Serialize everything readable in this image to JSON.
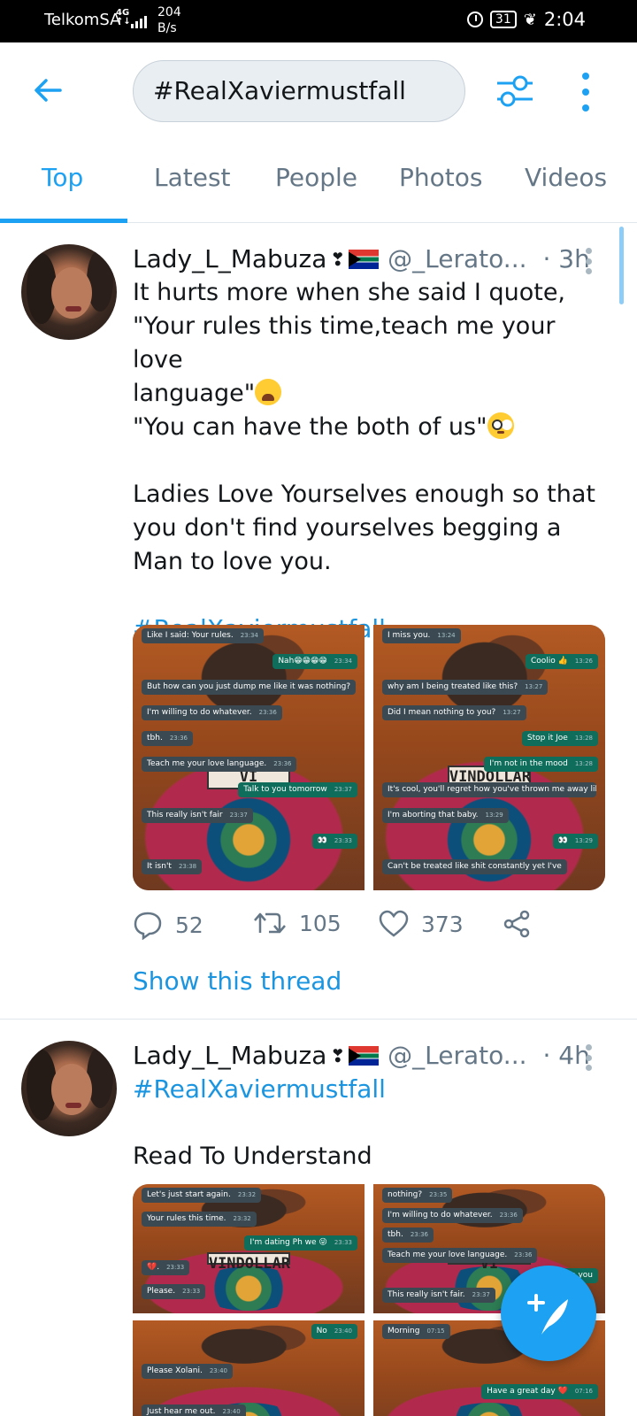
{
  "status_bar": {
    "carrier": "TelkomSA",
    "network": "4G",
    "data_speed_value": "204",
    "data_speed_unit": "B/s",
    "battery": "31",
    "time": "2:04"
  },
  "search": {
    "query": "#RealXaviermustfall"
  },
  "tabs": [
    {
      "label": "Top",
      "active": true
    },
    {
      "label": "Latest",
      "active": false
    },
    {
      "label": "People",
      "active": false
    },
    {
      "label": "Photos",
      "active": false
    },
    {
      "label": "Videos",
      "active": false
    }
  ],
  "colors": {
    "accent": "#1da1f2",
    "link": "#1b95e0",
    "muted": "#657786"
  },
  "tweets": [
    {
      "name": "Lady_L_Mabuza",
      "handle": "@_Lerato...",
      "time": "· 3h",
      "lines": [
        "It hurts more when she said I quote,",
        "\"Your rules this time,teach me your love",
        "language\"",
        "\"You can have the both of us\""
      ],
      "para2": "Ladies Love Yourselves enough so that you don't find yourselves begging a Man to love you.",
      "hashtag": "#RealXaviermustfall",
      "images": [
        {
          "cap": "VI",
          "bubbles": [
            {
              "text": "Like I said: Your rules.",
              "time": "23:34",
              "out": false
            },
            {
              "text": "Nah😁😁😁😁",
              "time": "23:34",
              "out": true
            },
            {
              "text": "But how can you just dump me like it was nothing?",
              "time": "23:35",
              "out": false
            },
            {
              "text": "I'm willing to do whatever.",
              "time": "23:36",
              "out": false
            },
            {
              "text": "tbh.",
              "time": "23:36",
              "out": false
            },
            {
              "text": "Teach me your love language.",
              "time": "23:36",
              "out": false
            },
            {
              "text": "Talk to you tomorrow",
              "time": "23:37",
              "out": true
            },
            {
              "text": "This really isn't fair",
              "time": "23:37",
              "out": false
            },
            {
              "text": "👀",
              "time": "23:33",
              "out": true
            },
            {
              "text": "It isn't",
              "time": "23:38",
              "out": false
            }
          ]
        },
        {
          "cap": "VINDOLLAR",
          "bubbles": [
            {
              "text": "I miss you.",
              "time": "13:24",
              "out": false
            },
            {
              "text": "Coolio 👍",
              "time": "13:26",
              "out": true
            },
            {
              "text": "why am I being treated like this?",
              "time": "13:27",
              "out": false
            },
            {
              "text": "Did I mean nothing to you?",
              "time": "13:27",
              "out": false
            },
            {
              "text": "Stop it Joe",
              "time": "13:28",
              "out": true
            },
            {
              "text": "I'm not in the mood",
              "time": "13:28",
              "out": true
            },
            {
              "text": "It's cool, you'll regret how you've thrown me away like I mean nothing.",
              "time": "13:29",
              "out": false
            },
            {
              "text": "I'm aborting that baby.",
              "time": "13:29",
              "out": false
            },
            {
              "text": "👀",
              "time": "13:29",
              "out": true
            },
            {
              "text": "Can't be treated like shit constantly yet I've",
              "time": "",
              "out": false
            }
          ]
        }
      ],
      "replies": "52",
      "retweets": "105",
      "likes": "373",
      "thread_link": "Show this thread"
    },
    {
      "name": "Lady_L_Mabuza",
      "handle": "@_Lerato...",
      "time": "· 4h",
      "hashtag": "#RealXaviermustfall",
      "body": "Read To Understand",
      "images": [
        {
          "cap": "VINDOLLAR",
          "bubbles": [
            {
              "text": "Let's just start again.",
              "time": "23:32",
              "out": false
            },
            {
              "text": "Your rules this time.",
              "time": "23:32",
              "out": false
            },
            {
              "text": "I'm dating Ph we 😜",
              "time": "23:33",
              "out": true
            },
            {
              "text": "💔.",
              "time": "23:33",
              "out": false
            },
            {
              "text": "Please.",
              "time": "23:33",
              "out": false
            }
          ]
        },
        {
          "cap": "VI",
          "bubbles": [
            {
              "text": "nothing?",
              "time": "23:35",
              "out": false
            },
            {
              "text": "I'm willing to do whatever.",
              "time": "23:36",
              "out": false
            },
            {
              "text": "tbh.",
              "time": "23:36",
              "out": false
            },
            {
              "text": "Teach me your love language.",
              "time": "23:36",
              "out": false
            },
            {
              "text": "Talk to you",
              "time": "",
              "out": true
            },
            {
              "text": "This really isn't fair.",
              "time": "23:37",
              "out": false
            }
          ]
        },
        {
          "cap": "",
          "bubbles": [
            {
              "text": "No",
              "time": "23:40",
              "out": true
            },
            {
              "text": "Please Xolani.",
              "time": "23:40",
              "out": false
            },
            {
              "text": "Just hear me out.",
              "time": "23:40",
              "out": false
            }
          ]
        },
        {
          "cap": "",
          "bubbles": [
            {
              "text": "Morning",
              "time": "07:15",
              "out": false
            },
            {
              "text": "Have a great day ❤️",
              "time": "07:16",
              "out": true
            }
          ]
        }
      ]
    }
  ]
}
